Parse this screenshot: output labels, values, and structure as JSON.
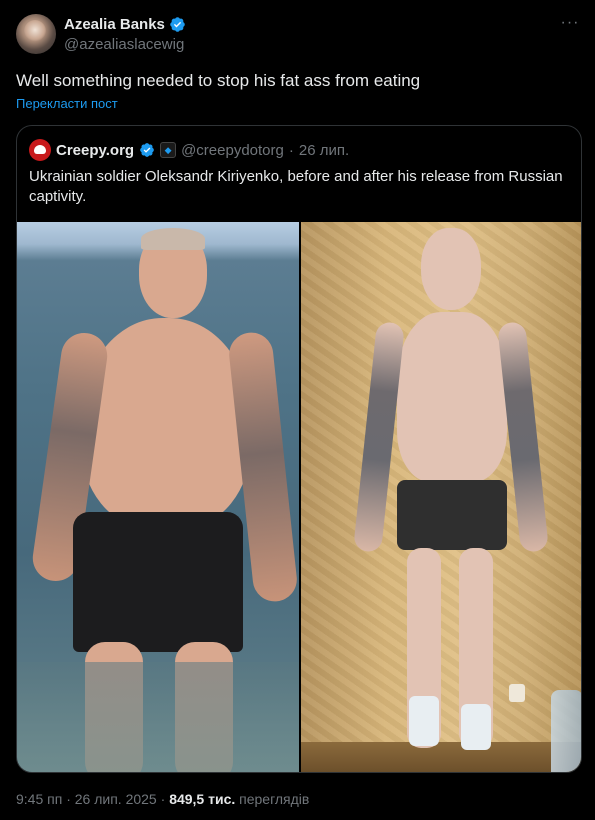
{
  "author": {
    "display_name": "Azealia Banks",
    "handle": "@azealiaslacewig"
  },
  "tweet": {
    "text": "Well something needed to stop his fat ass from eating",
    "translate_label": "Перекласти пост"
  },
  "quoted": {
    "display_name": "Creepy.org",
    "handle": "@creepydotorg",
    "separator": "·",
    "date": "26 лип.",
    "text": "Ukrainian soldier Oleksandr Kiriyenko, before and after his release from Russian captivity."
  },
  "footer": {
    "time": "9:45 пп",
    "sep1": "·",
    "date": "26 лип. 2025",
    "sep2": "·",
    "views_count": "849,5 тис.",
    "views_label": "переглядів"
  },
  "colors": {
    "background": "#000000",
    "text_primary": "#e7e9ea",
    "text_secondary": "#71767b",
    "accent": "#1d9bf0",
    "border": "#2f3336"
  },
  "icons": {
    "verified": "verified-badge-icon",
    "more": "more-options-icon",
    "affiliate": "affiliate-badge-icon"
  }
}
